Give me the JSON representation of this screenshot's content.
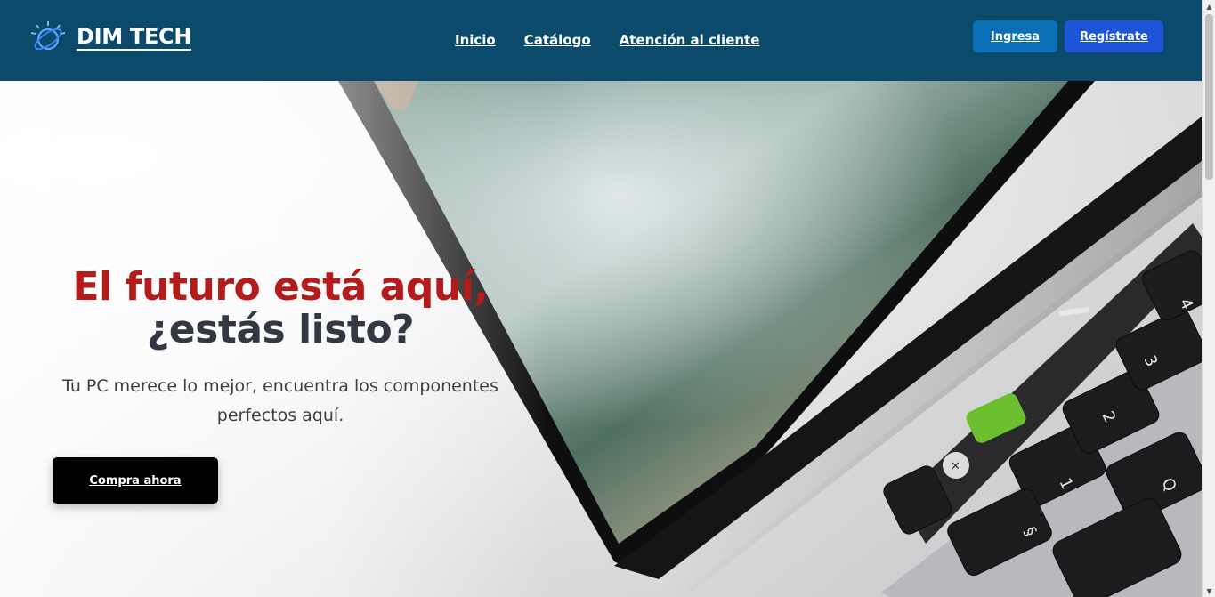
{
  "brand": {
    "name": "DIM TECH",
    "logo_icon": "globe-sparkle-icon"
  },
  "nav": {
    "items": [
      "Inicio",
      "Catálogo",
      "Atención al cliente"
    ]
  },
  "auth": {
    "login_label": "Ingresa",
    "register_label": "Regístrate"
  },
  "hero": {
    "title_line1": "El futuro está aquí,",
    "title_line2": "¿estás listo?",
    "subtitle": "Tu PC merece lo mejor, encuentra los componentes perfectos aquí.",
    "cta_label": "Compra ahora"
  },
  "colors": {
    "header_bg": "#0b4a6b",
    "login_bg": "#0a6fb4",
    "register_bg": "#1e55d8",
    "title_accent": "#b41b1b",
    "title_dark": "#333842",
    "cta_bg": "#000000"
  },
  "scrollbar": {
    "up_icon": "triangle-up-icon",
    "down_icon": "triangle-down-icon"
  }
}
